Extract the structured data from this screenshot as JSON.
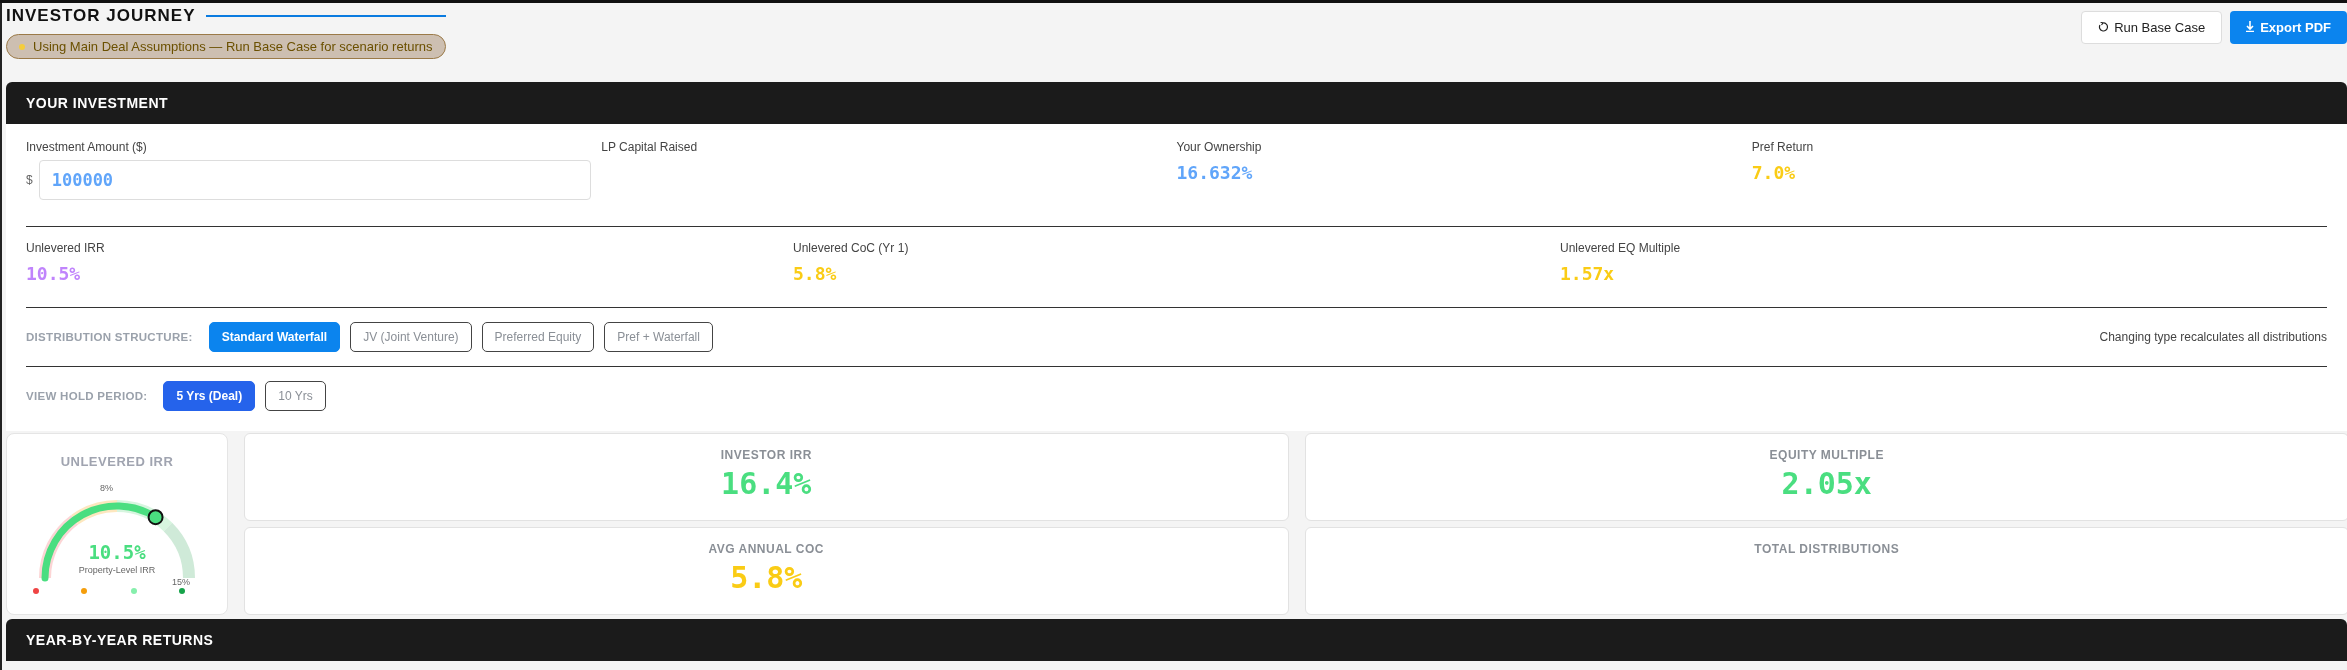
{
  "header": {
    "title": "INVESTOR JOURNEY",
    "notice": "Using Main Deal Assumptions — Run Base Case for scenario returns",
    "buttons": [
      {
        "label": "Run Base Case",
        "kind": "secondary"
      },
      {
        "label": "Export PDF",
        "kind": "primary"
      }
    ]
  },
  "investment": {
    "title": "YOUR INVESTMENT",
    "amount": {
      "label": "Investment Amount ($)",
      "prefix": "$",
      "value": "100000"
    },
    "summary": [
      {
        "label": "LP Capital Raised"
      },
      {
        "label": "Your Ownership",
        "value": "16.632%",
        "color": "#60a5fa"
      },
      {
        "label": "Pref Return",
        "value": "7.0%",
        "color": "#facc15"
      }
    ],
    "unlevered": [
      {
        "label": "Unlevered IRR",
        "value": "10.5%",
        "color": "#c084fc"
      },
      {
        "label": "Unlevered CoC (Yr 1)",
        "value": "5.8%",
        "color": "#facc15"
      },
      {
        "label": "Unlevered EQ Multiple",
        "value": "1.57x",
        "color": "#facc15"
      }
    ],
    "distribution": {
      "label": "DISTRIBUTION STRUCTURE:",
      "options": [
        {
          "label": "Standard Waterfall",
          "selected": true
        },
        {
          "label": "JV (Joint Venture)",
          "selected": false
        },
        {
          "label": "Preferred Equity",
          "selected": false
        },
        {
          "label": "Pref + Waterfall",
          "selected": false
        }
      ],
      "note": "Changing type recalculates all distributions"
    },
    "hold_period": {
      "label": "VIEW HOLD PERIOD:",
      "options": [
        {
          "label": "5 Yrs (Deal)",
          "selected": true
        },
        {
          "label": "10 Yrs",
          "selected": false
        }
      ]
    }
  },
  "gauge": {
    "title": "UNLEVERED IRR",
    "value": "10.5%",
    "caption": "Property-Level IRR",
    "tick_labels": [
      "8%",
      "15%"
    ]
  },
  "metrics": [
    {
      "label": "INVESTOR IRR",
      "value": "16.4%",
      "color": "#4ade80"
    },
    {
      "label": "EQUITY MULTIPLE",
      "value": "2.05x",
      "color": "#4ade80"
    },
    {
      "label": "AVG ANNUAL COC",
      "value": "5.8%",
      "color": "#facc15"
    },
    {
      "label": "TOTAL DISTRIBUTIONS"
    }
  ],
  "year_by_year": {
    "title": "YEAR-BY-YEAR RETURNS"
  }
}
